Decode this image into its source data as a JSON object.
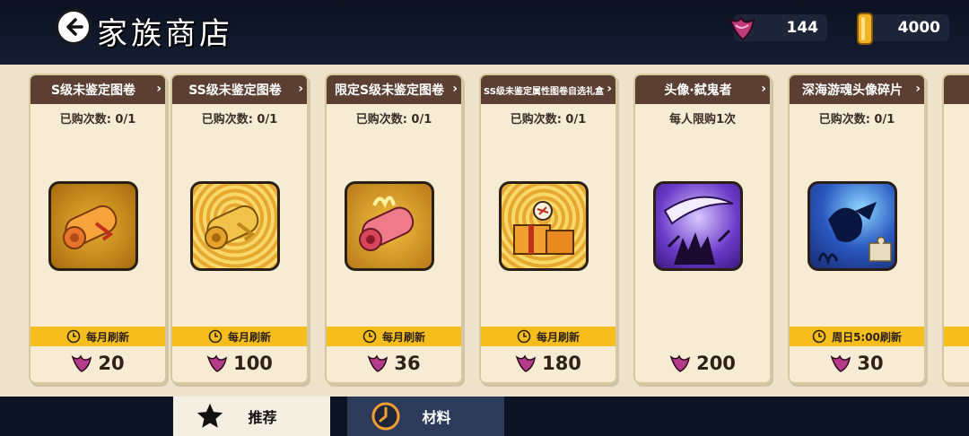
{
  "header": {
    "title": "家族商店",
    "currencies": [
      {
        "icon": "bat-wing-token-icon",
        "value": "144"
      },
      {
        "icon": "gold-bar-icon",
        "value": "4000"
      }
    ]
  },
  "items": [
    {
      "title": "S级未鉴定图卷",
      "limit": "已购次数: 0/1",
      "icon": "orange-scroll-icon",
      "refresh": "每月刷新",
      "price": "20"
    },
    {
      "title": "SS级未鉴定图卷",
      "limit": "已购次数: 0/1",
      "icon": "gold-scroll-icon",
      "refresh": "每月刷新",
      "price": "100"
    },
    {
      "title": "限定S级未鉴定图卷",
      "limit": "已购次数: 0/1",
      "icon": "pink-scroll-icon",
      "refresh": "每月刷新",
      "price": "36"
    },
    {
      "title": "SS级未鉴定属性图卷自选礼盒",
      "limit": "已购次数: 0/1",
      "icon": "gift-box-icon",
      "refresh": "每月刷新",
      "price": "180"
    },
    {
      "title": "头像·弑鬼者",
      "limit": "每人限购1次",
      "icon": "demon-slayer-avatar-icon",
      "refresh": "",
      "price": "200"
    },
    {
      "title": "深海游魂头像碎片",
      "limit": "已购次数: 0/1",
      "icon": "deep-sea-avatar-fragment-icon",
      "refresh": "周日5:00刷新",
      "price": "30"
    }
  ],
  "tabs": [
    {
      "label": "推荐",
      "icon": "star-icon",
      "active": true
    },
    {
      "label": "材料",
      "icon": "clock-icon",
      "active": false
    }
  ],
  "colors": {
    "card_header": "#5b3f32",
    "refresh_bar": "#f5be1d",
    "tab_active": "#f5efe3",
    "tab_inactive": "#2e3a5a"
  }
}
